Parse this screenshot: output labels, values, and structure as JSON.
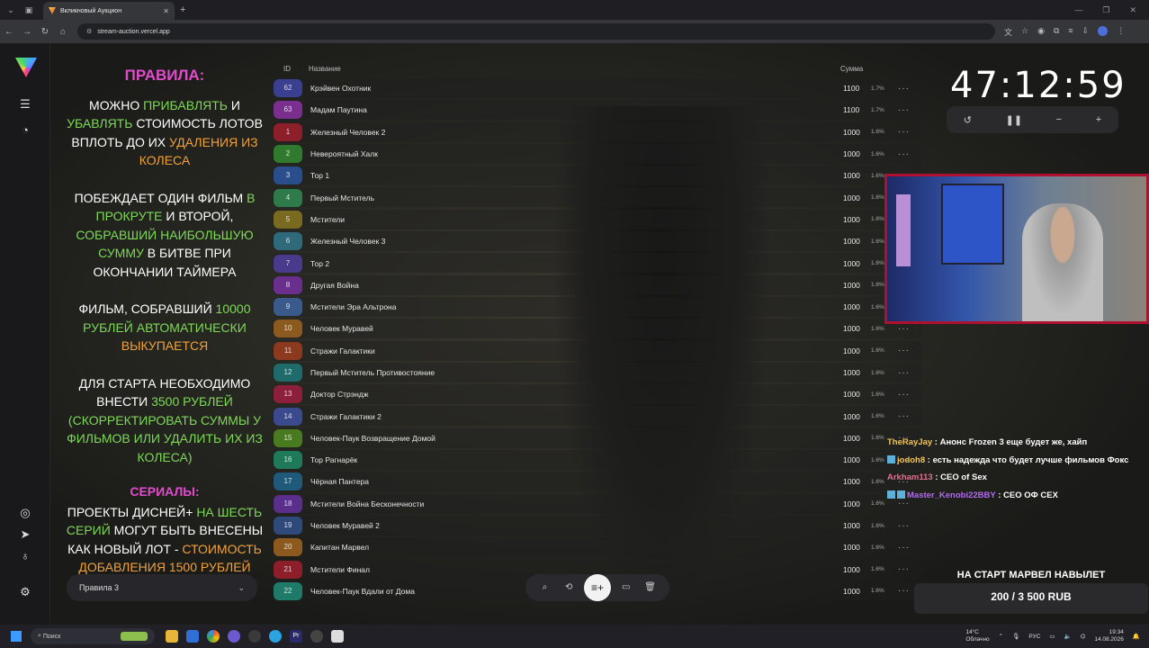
{
  "browser": {
    "tab_title": "Вкликновый Аукцион",
    "url": "stream-auction.vercel.app"
  },
  "rules": {
    "title": "ПРАВИЛА:",
    "p1": {
      "a": "МОЖНО ",
      "b": "ПРИБАВЛЯТЬ",
      "c": " И ",
      "d": "УБАВЛЯТЬ",
      "e": " СТОИМОСТЬ ЛОТОВ ВПЛОТЬ ДО ИХ ",
      "f": "УДАЛЕНИЯ ИЗ КОЛЕСА"
    },
    "p2": {
      "a": "ПОБЕЖДАЕТ ОДИН ФИЛЬМ ",
      "b": "В ПРОКРУТЕ",
      "c": " И ВТОРОЙ, ",
      "d": "СОБРАВШИЙ НАИБОЛЬШУЮ СУММУ",
      "e": " В БИТВЕ ПРИ ОКОНЧАНИИ ТАЙМЕРА"
    },
    "p3": {
      "a": "ФИЛЬМ, СОБРАВШИЙ ",
      "b": "10000 РУБЛЕЙ АВТОМАТИЧЕСКИ",
      "c": " ",
      "d": "ВЫКУПАЕТСЯ"
    },
    "p4": {
      "a": "ДЛЯ СТАРТА НЕОБХОДИМО ВНЕСТИ ",
      "b": "3500 РУБЛЕЙ (СКОРРЕКТИРОВАТЬ СУММЫ У ФИЛЬМОВ ИЛИ УДАЛИТЬ ИХ ИЗ КОЛЕСА)"
    },
    "series_title": "СЕРИАЛЫ:",
    "p5": {
      "a": "ПРОЕКТЫ ДИСНЕЙ+ ",
      "b": "НА ШЕСТЬ СЕРИЙ",
      "c": " МОГУТ БЫТЬ ВНЕСЕНЫ КАК НОВЫЙ ЛОТ - ",
      "d": "СТОИМОСТЬ ДОБАВЛЕНИЯ 1500 РУБЛЕЙ"
    },
    "select_value": "Правила 3"
  },
  "table": {
    "headers": {
      "id": "ID",
      "name": "Название",
      "sum": "Сумма"
    },
    "rows": [
      {
        "id": "62",
        "name": "Крэйвен Охотник",
        "sum": "1100",
        "pct": "1.7%",
        "color": "#3a3f8f"
      },
      {
        "id": "63",
        "name": "Мадам Паутина",
        "sum": "1100",
        "pct": "1.7%",
        "color": "#7a2f8f"
      },
      {
        "id": "1",
        "name": "Железный Человек 2",
        "sum": "1000",
        "pct": "1.6%",
        "color": "#8c1f2a"
      },
      {
        "id": "2",
        "name": "Невероятный Халк",
        "sum": "1000",
        "pct": "1.6%",
        "color": "#2f7a2f"
      },
      {
        "id": "3",
        "name": "Тор 1",
        "sum": "1000",
        "pct": "1.6%",
        "color": "#2a4d8c"
      },
      {
        "id": "4",
        "name": "Первый Мститель",
        "sum": "1000",
        "pct": "1.6%",
        "color": "#2f7a4a"
      },
      {
        "id": "5",
        "name": "Мстители",
        "sum": "1000",
        "pct": "1.6%",
        "color": "#7a6a1f"
      },
      {
        "id": "6",
        "name": "Железный Человек 3",
        "sum": "1000",
        "pct": "1.6%",
        "color": "#2f6a7a"
      },
      {
        "id": "7",
        "name": "Тор 2",
        "sum": "1000",
        "pct": "1.6%",
        "color": "#4a3a8c"
      },
      {
        "id": "8",
        "name": "Другая Война",
        "sum": "1000",
        "pct": "1.6%",
        "color": "#6a2f8c"
      },
      {
        "id": "9",
        "name": "Мстители Эра Альтрона",
        "sum": "1000",
        "pct": "1.6%",
        "color": "#3a5a8c"
      },
      {
        "id": "10",
        "name": "Человек Муравей",
        "sum": "1000",
        "pct": "1.6%",
        "color": "#8c5a1f"
      },
      {
        "id": "11",
        "name": "Стражи Галактики",
        "sum": "1000",
        "pct": "1.6%",
        "color": "#8c3a1f"
      },
      {
        "id": "12",
        "name": "Первый Мститель Противостояние",
        "sum": "1000",
        "pct": "1.6%",
        "color": "#1f6a6a"
      },
      {
        "id": "13",
        "name": "Доктор Стрэндж",
        "sum": "1000",
        "pct": "1.6%",
        "color": "#8c1f3a"
      },
      {
        "id": "14",
        "name": "Стражи Галактики 2",
        "sum": "1000",
        "pct": "1.6%",
        "color": "#3a4a8c"
      },
      {
        "id": "15",
        "name": "Человек-Паук Возвращение Домой",
        "sum": "1000",
        "pct": "1.6%",
        "color": "#4a7a1f"
      },
      {
        "id": "16",
        "name": "Тор Рагнарёк",
        "sum": "1000",
        "pct": "1.6%",
        "color": "#1f7a5a"
      },
      {
        "id": "17",
        "name": "Чёрная Пантера",
        "sum": "1000",
        "pct": "1.6%",
        "color": "#1f5a7a"
      },
      {
        "id": "18",
        "name": "Мстители Война Бесконечности",
        "sum": "1000",
        "pct": "1.6%",
        "color": "#5a2f8c"
      },
      {
        "id": "19",
        "name": "Человек Муравей 2",
        "sum": "1000",
        "pct": "1.6%",
        "color": "#2f4a7a"
      },
      {
        "id": "20",
        "name": "Капитан Марвел",
        "sum": "1000",
        "pct": "1.6%",
        "color": "#8c5a1f"
      },
      {
        "id": "21",
        "name": "Мстители Финал",
        "sum": "1000",
        "pct": "1.6%",
        "color": "#8c1f2a"
      },
      {
        "id": "22",
        "name": "Человек-Паук Вдали от Дома",
        "sum": "1000",
        "pct": "1.6%",
        "color": "#1f7a6a"
      }
    ]
  },
  "timer": {
    "value": "47:12:59"
  },
  "chat": [
    {
      "user": "TheRayJay",
      "color": "#f2c45a",
      "text": " : Анонс Frozen 3 еще будет же, хайп",
      "badges": 0
    },
    {
      "user": "jodoh8",
      "color": "#f2c45a",
      "text": " : есть надежда что будет лучше фильмов Фокс",
      "badges": 1
    },
    {
      "user": "Arkham113",
      "color": "#e07090",
      "text": " : CEO of Sex",
      "badges": 0
    },
    {
      "user": "Master_Kenobi22BBY",
      "color": "#b06cf0",
      "text": " : CEO ОФ СЕХ",
      "badges": 2
    }
  ],
  "goal": {
    "title": "НА СТАРТ МАРВЕЛ НАВЫЛЕТ",
    "value": "200 / 3 500 RUB"
  },
  "taskbar": {
    "search_placeholder": "Поиск",
    "temp": "14°C",
    "weather": "Облачно",
    "lang": "РУС",
    "time": "19:34",
    "date": "14.08.2026"
  },
  "colors": {
    "accent_green": "#7ed957",
    "accent_orange": "#f0a23a",
    "accent_pink": "#e14ccc"
  }
}
